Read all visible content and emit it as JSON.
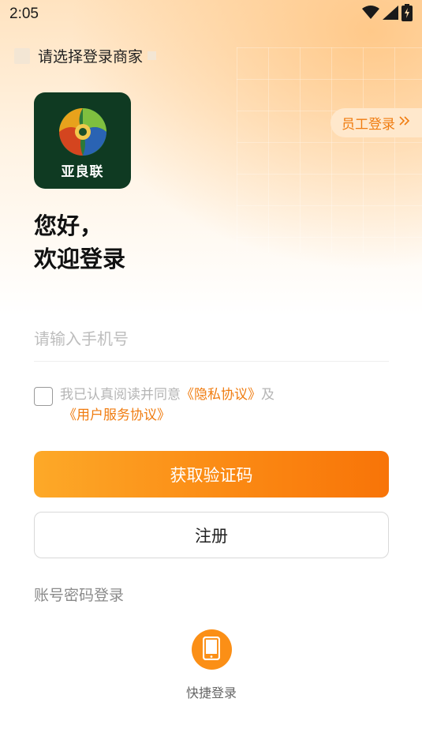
{
  "status_bar": {
    "time": "2:05",
    "icons": [
      "wifi-icon",
      "cellular-signal-icon",
      "battery-charging-icon"
    ]
  },
  "merchant_select": {
    "label": "请选择登录商家"
  },
  "staff_login": {
    "label": "员工登录",
    "icon": "double-chevron-right-icon"
  },
  "logo": {
    "text": "亚良联"
  },
  "greeting": {
    "line1": "您好，",
    "line2": "欢迎登录"
  },
  "phone": {
    "value": "",
    "placeholder": "请输入手机号"
  },
  "agreement": {
    "checked": false,
    "prefix": "我已认真阅读并同意",
    "privacy_link": "《隐私协议》",
    "joiner": "及",
    "service_link": "《用户服务协议》"
  },
  "buttons": {
    "get_code": "获取验证码",
    "register": "注册"
  },
  "account_login": "账号密码登录",
  "quick_login": {
    "label": "快捷登录",
    "icon": "mobile-phone-icon"
  },
  "colors": {
    "accent": "#f87e10",
    "accent_light": "#ffe8cc",
    "logo_bg": "#0f3a22"
  }
}
